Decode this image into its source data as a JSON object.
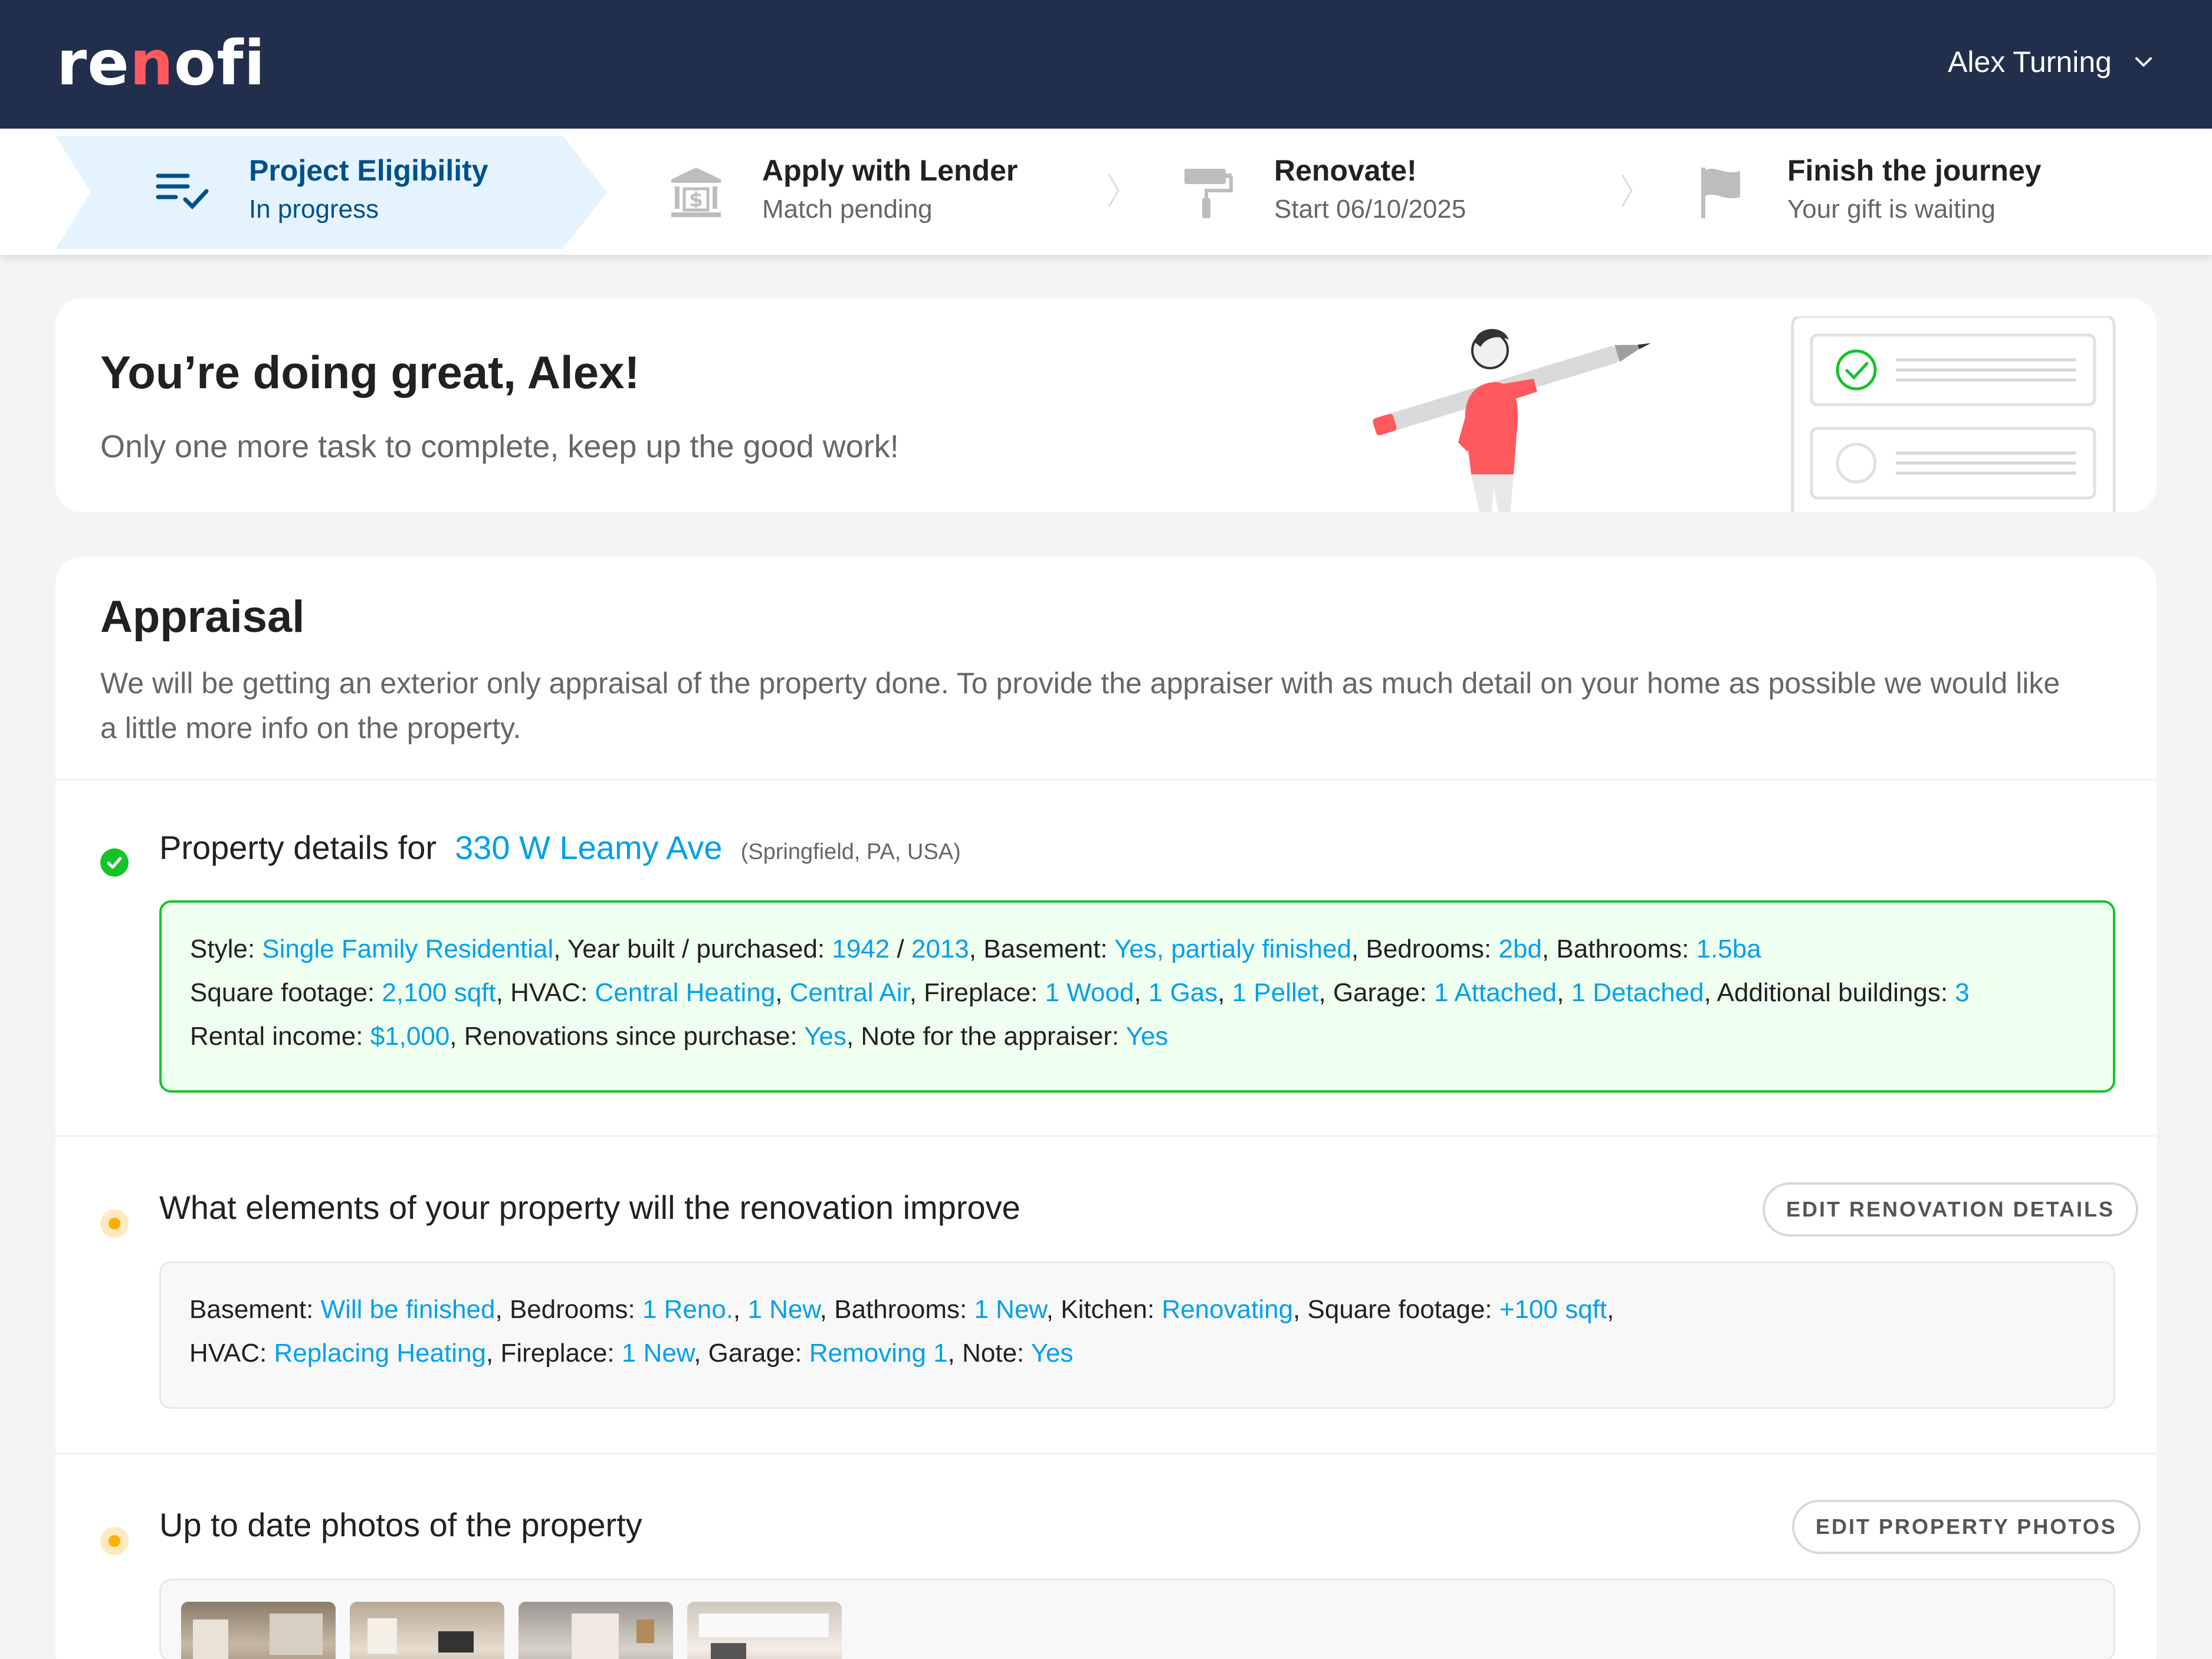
{
  "header": {
    "logo_pre": "re",
    "logo_accent": "n",
    "logo_post": "ofi",
    "user_name": "Alex Turning"
  },
  "steps": [
    {
      "title": "Project Eligibility",
      "sub": "In progress",
      "icon": "checklist-icon",
      "active": true
    },
    {
      "title": "Apply with Lender",
      "sub": "Match pending",
      "icon": "bank-icon",
      "active": false
    },
    {
      "title": "Renovate!",
      "sub": "Start 06/10/2025",
      "icon": "paint-roller-icon",
      "active": false
    },
    {
      "title": "Finish the journey",
      "sub": "Your gift is waiting",
      "icon": "flag-icon",
      "active": false
    }
  ],
  "hero": {
    "title": "You’re doing great, Alex!",
    "subtitle": "Only one more task to complete, keep up the good work!"
  },
  "appraisal": {
    "title": "Appraisal",
    "description": "We will be getting an exterior only appraisal of the property done. To provide the appraiser with as much detail on your home as possible we would like a little more info on the property.",
    "property": {
      "label": "Property details for",
      "address": "330 W Leamy Ave",
      "location": "(Springfield, PA, USA)",
      "status": "complete"
    },
    "details": {
      "style_k": "Style:",
      "style_v": "Single Family Residential",
      "year_k": "Year built / purchased:",
      "year_built": "1942",
      "year_purchased": "2013",
      "basement_k": "Basement:",
      "basement_v": "Yes, partialy finished",
      "bedrooms_k": "Bedrooms:",
      "bedrooms_v": "2bd",
      "bathrooms_k": "Bathrooms:",
      "bathrooms_v": "1.5ba",
      "sqft_k": "Square footage:",
      "sqft_v": "2,100 sqft",
      "hvac_k": "HVAC:",
      "hvac_v1": "Central Heating",
      "hvac_v2": "Central Air",
      "fireplace_k": "Fireplace:",
      "fire_v1": "1 Wood",
      "fire_v2": "1 Gas",
      "fire_v3": "1 Pellet",
      "garage_k": "Garage:",
      "garage_v1": "1 Attached",
      "garage_v2": "1 Detached",
      "additional_k": "Additional buildings:",
      "additional_v": "3",
      "rental_k": "Rental income:",
      "rental_v": "$1,000",
      "renos_k": "Renovations since purchase:",
      "renos_v": "Yes",
      "note_k": "Note for the appraiser:",
      "note_v": "Yes"
    },
    "renovation": {
      "title": "What elements of your property will the renovation improve",
      "button": "EDIT RENOVATION DETAILS",
      "status": "pending",
      "basement_k": "Basement:",
      "basement_v": "Will be finished",
      "bedrooms_k": "Bedrooms:",
      "bed_v1": "1 Reno.",
      "bed_v2": "1 New",
      "bathrooms_k": "Bathrooms:",
      "bath_v": "1 New",
      "kitchen_k": "Kitchen:",
      "kitchen_v": "Renovating",
      "sqft_k": "Square footage:",
      "sqft_v": "+100 sqft",
      "hvac_k": "HVAC:",
      "hvac_v": "Replacing Heating",
      "fireplace_k": "Fireplace:",
      "fire_v": "1 New",
      "garage_k": "Garage:",
      "garage_v": "Removing 1",
      "note_k": "Note:",
      "note_v": "Yes"
    },
    "photos": {
      "title": "Up to date photos of the property",
      "button": "EDIT PROPERTY PHOTOS",
      "status": "pending"
    }
  },
  "colors": {
    "navy": "#212f4c",
    "accent_red": "#ff595e",
    "link_blue": "#00a0ea",
    "active_step_blue": "#00508c",
    "success_green": "#13c427",
    "pending_yellow": "#ffb000"
  }
}
